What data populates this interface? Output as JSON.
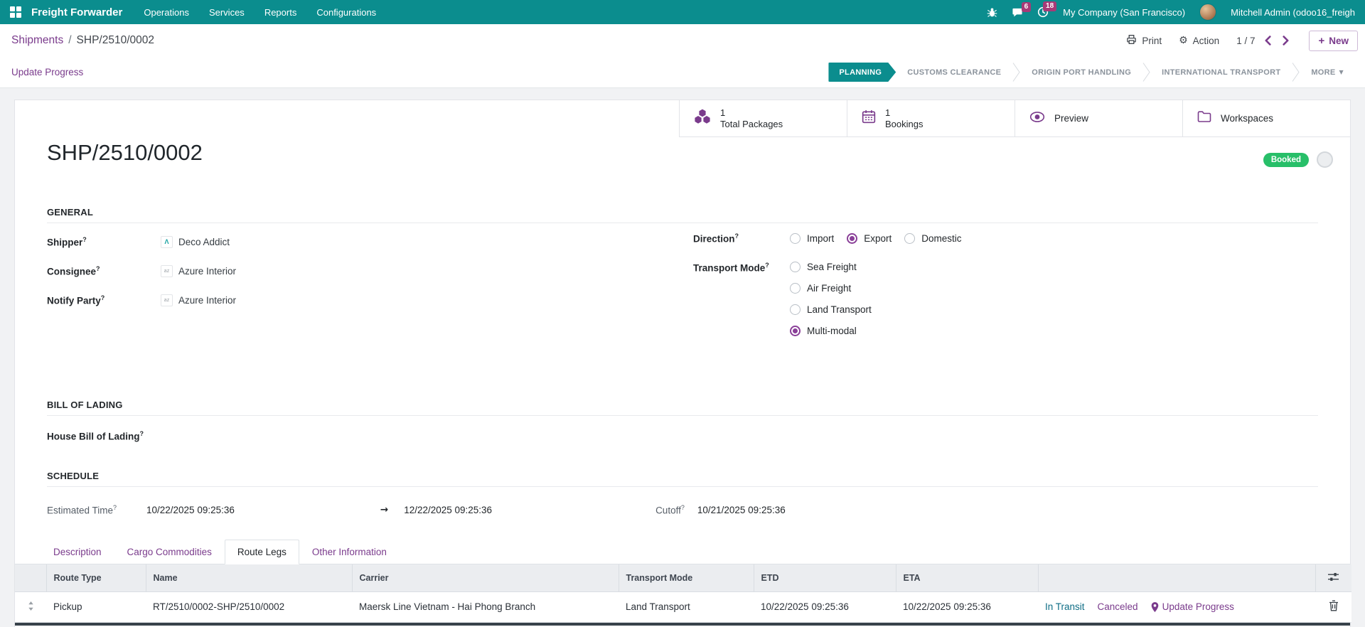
{
  "navbar": {
    "brand": "Freight Forwarder",
    "menus": [
      "Operations",
      "Services",
      "Reports",
      "Configurations"
    ],
    "messages_badge": "6",
    "activities_badge": "18",
    "company": "My Company (San Francisco)",
    "user": "Mitchell Admin (odoo16_freigh"
  },
  "control_panel": {
    "breadcrumb_parent": "Shipments",
    "breadcrumb_separator": "/",
    "breadcrumb_current": "SHP/2510/0002",
    "print_label": "Print",
    "action_label": "Action",
    "pager": "1 / 7",
    "new_label": "New"
  },
  "statusbar": {
    "update_progress_label": "Update Progress",
    "stages": [
      "PLANNING",
      "CUSTOMS CLEARANCE",
      "ORIGIN PORT HANDLING",
      "INTERNATIONAL TRANSPORT"
    ],
    "active_stage": "PLANNING",
    "more_label": "MORE"
  },
  "button_box": {
    "total_packages": {
      "value": "1",
      "label": "Total Packages"
    },
    "bookings": {
      "value": "1",
      "label": "Bookings"
    },
    "preview_label": "Preview",
    "workspaces_label": "Workspaces"
  },
  "record": {
    "title": "SHP/2510/0002",
    "status_badge": "Booked"
  },
  "general": {
    "section_title": "GENERAL",
    "shipper": {
      "label": "Shipper",
      "value": "Deco Addict"
    },
    "consignee": {
      "label": "Consignee",
      "value": "Azure Interior"
    },
    "notify_party": {
      "label": "Notify Party",
      "value": "Azure Interior"
    },
    "direction": {
      "label": "Direction",
      "options": [
        "Import",
        "Export",
        "Domestic"
      ],
      "selected": "Export"
    },
    "transport_mode": {
      "label": "Transport Mode",
      "options": [
        "Sea Freight",
        "Air Freight",
        "Land Transport",
        "Multi-modal"
      ],
      "selected": "Multi-modal"
    }
  },
  "bill_of_lading": {
    "section_title": "BILL OF LADING",
    "house_bl_label": "House Bill of Lading",
    "house_bl_value": ""
  },
  "schedule": {
    "section_title": "SCHEDULE",
    "estimated_time_label": "Estimated Time",
    "start": "10/22/2025 09:25:36",
    "arrow": "→",
    "end": "12/22/2025 09:25:36",
    "cutoff_label": "Cutoff",
    "cutoff": "10/21/2025 09:25:36"
  },
  "notebook": {
    "tabs": [
      "Description",
      "Cargo Commodities",
      "Route Legs",
      "Other Information"
    ],
    "active_tab": "Route Legs"
  },
  "route_legs": {
    "columns": [
      "Route Type",
      "Name",
      "Carrier",
      "Transport Mode",
      "ETD",
      "ETA"
    ],
    "rows": [
      {
        "route_type": "Pickup",
        "name": "RT/2510/0002-SHP/2510/0002",
        "carrier": "Maersk Line Vietnam - Hai Phong Branch",
        "transport_mode": "Land Transport",
        "etd": "10/22/2025 09:25:36",
        "eta": "10/22/2025 09:25:36",
        "actions": {
          "in_transit": "In Transit",
          "canceled": "Canceled",
          "update_progress": "Update Progress"
        }
      }
    ]
  },
  "ui": {
    "help_marker": "?",
    "plus": "+",
    "more_caret": "▼"
  },
  "colors": {
    "navbar_teal": "#0b8d8e",
    "accent_purple": "#7a3b8c",
    "badge_magenta": "#a73a77",
    "booked_green": "#28bf69",
    "in_transit_blue": "#0e6d85"
  }
}
